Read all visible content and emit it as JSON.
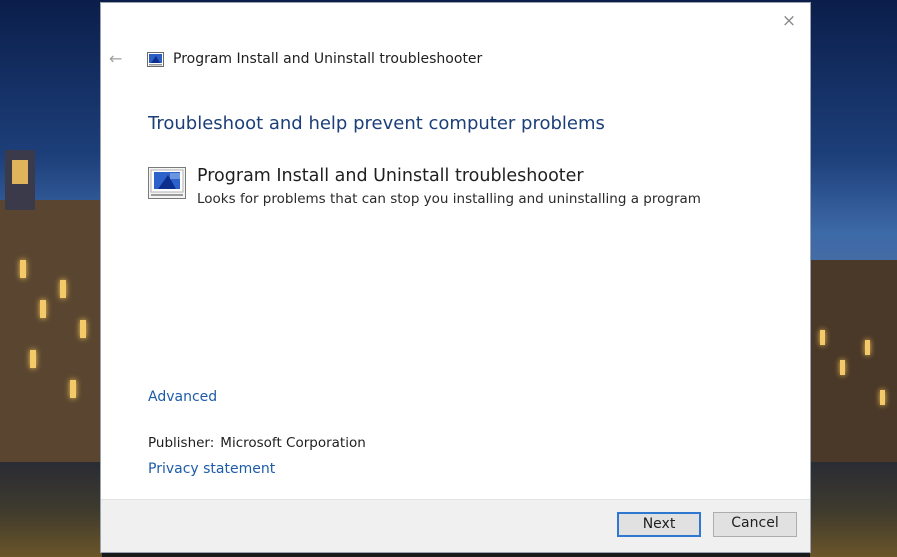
{
  "dialog": {
    "title": "Program Install and Uninstall troubleshooter",
    "heading": "Troubleshoot and help prevent computer problems",
    "troubleshooter": {
      "name": "Program Install and Uninstall troubleshooter",
      "description": "Looks for problems that can stop you installing and uninstalling a program",
      "icon": "program-troubleshooter-icon"
    },
    "advanced_link": "Advanced",
    "publisher_label": "Publisher:",
    "publisher_value": "Microsoft Corporation",
    "privacy_link": "Privacy statement",
    "buttons": {
      "next": "Next",
      "cancel": "Cancel"
    },
    "icons": {
      "close": "×",
      "back": "←"
    }
  },
  "colors": {
    "heading": "#1c3f7a",
    "link": "#1d5ca8",
    "next_border": "#2f78d2",
    "footer_bg": "#f0f0f0"
  }
}
